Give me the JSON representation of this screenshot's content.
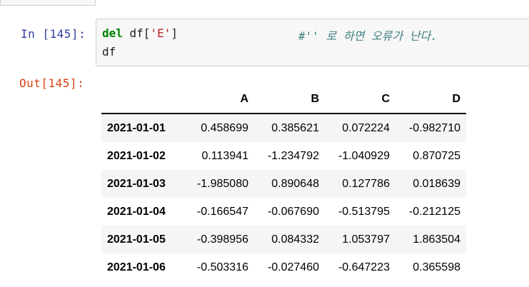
{
  "input_prompt": "In [145]:",
  "output_prompt": "Out[145]:",
  "code": {
    "line1": {
      "keyword": "del",
      "text_before_string": " df[",
      "string": "'E'",
      "text_after_string": "]",
      "comment": "#'' 로 하면 오류가 난다."
    },
    "line2": "df"
  },
  "dataframe": {
    "columns": [
      "A",
      "B",
      "C",
      "D"
    ],
    "rows": [
      {
        "index": "2021-01-01",
        "values": [
          "0.458699",
          "0.385621",
          "0.072224",
          "-0.982710"
        ]
      },
      {
        "index": "2021-01-02",
        "values": [
          "0.113941",
          "-1.234792",
          "-1.040929",
          "0.870725"
        ]
      },
      {
        "index": "2021-01-03",
        "values": [
          "-1.985080",
          "0.890648",
          "0.127786",
          "0.018639"
        ]
      },
      {
        "index": "2021-01-04",
        "values": [
          "-0.166547",
          "-0.067690",
          "-0.513795",
          "-0.212125"
        ]
      },
      {
        "index": "2021-01-05",
        "values": [
          "-0.398956",
          "0.084332",
          "1.053797",
          "1.863504"
        ]
      },
      {
        "index": "2021-01-06",
        "values": [
          "-0.503316",
          "-0.027460",
          "-0.647223",
          "0.365598"
        ]
      }
    ]
  }
}
